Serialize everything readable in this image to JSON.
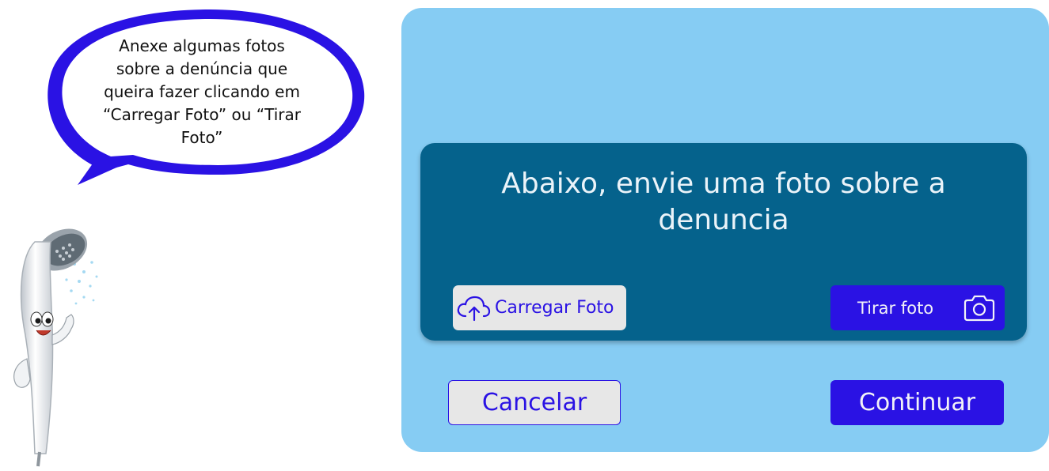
{
  "bubble": {
    "lines": [
      "Anexe algumas fotos",
      "sobre a denúncia que",
      "queira fazer clicando em",
      "“Carregar Foto” ou “Tirar",
      "Foto”"
    ]
  },
  "card": {
    "title_line1": "Abaixo, envie uma foto sobre a",
    "title_line2": "denuncia",
    "upload_label": "Carregar Foto",
    "upload_icon": "cloud-upload-icon",
    "camera_label": "Tirar foto",
    "camera_icon": "camera-icon"
  },
  "actions": {
    "cancel_label": "Cancelar",
    "continue_label": "Continuar"
  },
  "colors": {
    "panel": "#86ccf3",
    "card": "#05628c",
    "accent": "#2a12e4",
    "light_button": "#e7e7e7"
  }
}
